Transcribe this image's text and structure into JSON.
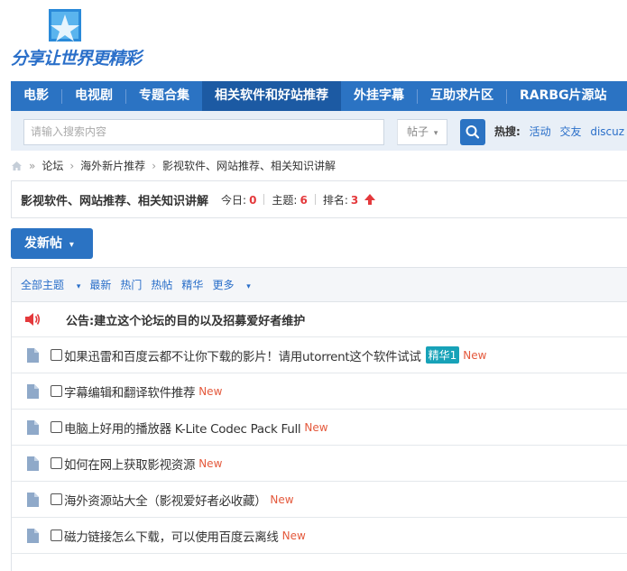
{
  "logo": {
    "text": "分享让世界更精彩"
  },
  "nav": {
    "items": [
      "电影",
      "电视剧",
      "专题合集",
      "相关软件和好站推荐",
      "外挂字幕",
      "互助求片区",
      "RARBG片源站"
    ],
    "active_index": 3
  },
  "search": {
    "placeholder": "请输入搜索内容",
    "type_label": "帖子",
    "hot_label": "热搜:",
    "hot_links": [
      "活动",
      "交友",
      "discuz"
    ]
  },
  "breadcrumb": [
    "论坛",
    "海外新片推荐",
    "影视软件、网站推荐、相关知识讲解"
  ],
  "forum": {
    "title": "影视软件、网站推荐、相关知识讲解",
    "today_label": "今日:",
    "today": "0",
    "topics_label": "主题:",
    "topics": "6",
    "rank_label": "排名:",
    "rank": "3"
  },
  "new_post_label": "发新帖",
  "filters": [
    "全部主题",
    "最新",
    "热门",
    "热帖",
    "精华",
    "更多"
  ],
  "announcement": "公告:建立这个论坛的目的以及招募爱好者维护",
  "threads": [
    {
      "title": "如果迅雷和百度云都不让你下载的影片！请用utorrent这个软件试试",
      "tag": "精华1",
      "badge": "New"
    },
    {
      "title": "字幕编辑和翻译软件推荐",
      "badge": "New"
    },
    {
      "title": "电脑上好用的播放器 K-Lite Codec Pack Full",
      "badge": "New"
    },
    {
      "title": "如何在网上获取影视资源",
      "badge": "New"
    },
    {
      "title": "海外资源站大全（影视爱好者必收藏）",
      "badge": "New"
    },
    {
      "title": "磁力链接怎么下载，可以使用百度云离线",
      "badge": "New"
    }
  ],
  "colors": {
    "nav_bg": "#2b73c3",
    "nav_active": "#1c5aa3",
    "accent_red": "#e4393c",
    "tag_bg": "#17a2b8",
    "new_color": "#e4593c"
  },
  "icons": {
    "search": "search-icon",
    "home": "home-icon",
    "rank_up": "arrow-up-icon",
    "speaker": "speaker-icon",
    "thread": "document-icon"
  }
}
